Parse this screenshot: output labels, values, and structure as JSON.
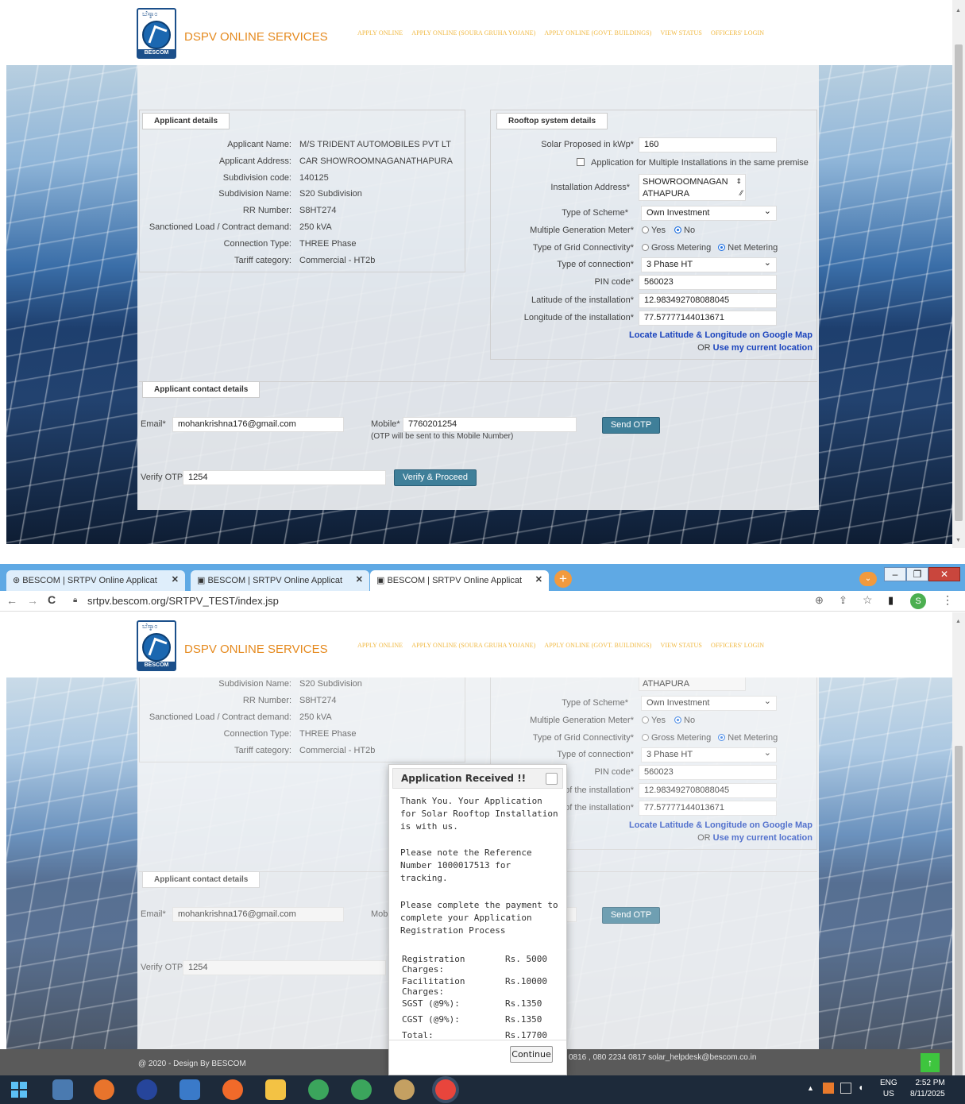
{
  "header": {
    "logo_text_top": "ಬೆಸ್ಕಾಂ",
    "logo_text_bottom": "BESCOM",
    "brand": "DSPV ONLINE SERVICES",
    "nav": [
      "APPLY ONLINE",
      "APPLY ONLINE (SOURA GRUHA YOJANE)",
      "APPLY ONLINE (GOVT. BUILDINGS)",
      "VIEW STATUS",
      "OFFICERS' LOGIN"
    ]
  },
  "applicant": {
    "legend": "Applicant details",
    "fields": [
      {
        "label": "Applicant Name:",
        "value": "M/S TRIDENT AUTOMOBILES PVT LT"
      },
      {
        "label": "Applicant Address:",
        "value": "CAR SHOWROOMNAGANATHAPURA"
      },
      {
        "label": "Subdivision code:",
        "value": "140125"
      },
      {
        "label": "Subdivision Name:",
        "value": "S20 Subdivision"
      },
      {
        "label": "RR Number:",
        "value": "S8HT274"
      },
      {
        "label": "Sanctioned Load / Contract demand:",
        "value": "250 kVA"
      },
      {
        "label": "Connection Type:",
        "value": "THREE Phase"
      },
      {
        "label": "Tariff category:",
        "value": "Commercial - HT2b"
      }
    ]
  },
  "rooftop": {
    "legend": "Rooftop system details",
    "solar_label": "Solar Proposed in kWp*",
    "solar_value": "160",
    "multi_install": "Application for Multiple Installations in the same premise",
    "install_addr_label": "Installation Address*",
    "install_addr_line1": "SHOWROOMNAGAN",
    "install_addr_line2": "ATHAPURA",
    "scheme_label": "Type of Scheme*",
    "scheme_value": "Own Investment",
    "multi_meter_label": "Multiple Generation Meter*",
    "yes": "Yes",
    "no": "No",
    "grid_label": "Type of Grid Connectivity*",
    "gross": "Gross Metering",
    "net": "Net Metering",
    "conn_label": "Type of connection*",
    "conn_value": "3 Phase HT",
    "pin_label": "PIN code*",
    "pin_value": "560023",
    "lat_label": "Latitude of the installation*",
    "lat_value": "12.983492708088045",
    "lon_label": "Longitude of the installation*",
    "lon_value": "77.57777144013671",
    "locate_link": "Locate Latitude & Longitude on Google Map",
    "or_text": "OR",
    "current_link": "Use my current location"
  },
  "contact": {
    "legend": "Applicant contact details",
    "email_label": "Email*",
    "email_value": "mohankrishna176@gmail.com",
    "mobile_label": "Mobile*",
    "mobile_value": "7760201254",
    "otp_note": "(OTP will be sent to this Mobile Number)",
    "send_otp": "Send OTP",
    "verify_label": "Verify OTP",
    "verify_value": "1254",
    "verify_btn": "Verify & Proceed"
  },
  "browser": {
    "tabs": [
      "BESCOM | SRTPV Online Applicat",
      "BESCOM | SRTPV Online Applicat",
      "BESCOM | SRTPV Online Applicat"
    ],
    "url": "srtpv.bescom.org/SRTPV_TEST/index.jsp",
    "profile_initial": "S"
  },
  "dialog": {
    "title": "Application Received !!",
    "p1": "Thank You. Your Application for Solar Rooftop Installation is with us.",
    "p2": "Please note the Reference Number 1000017513 for tracking.",
    "p3": "Please complete the payment to complete your Application Registration Process",
    "charges": [
      {
        "label": "Registration Charges:",
        "value": "Rs. 5000"
      },
      {
        "label": "Facilitation Charges:",
        "value": "Rs.10000"
      },
      {
        "label": "SGST (@9%):",
        "value": "Rs.1350"
      },
      {
        "label": "CGST (@9%):",
        "value": "Rs.1350"
      },
      {
        "label": "Total:",
        "value": "Rs.17700"
      }
    ],
    "continue": "Continue"
  },
  "footer": {
    "copyright": "@ 2020 - Design By  BESCOM",
    "contact": "0816 , 080 2234 0817   solar_helpdesk@bescom.co.in",
    "up_arrow": "↑"
  },
  "taskbar": {
    "lang": "ENG",
    "region": "US",
    "time": "2:52 PM",
    "date": "8/11/2025"
  }
}
